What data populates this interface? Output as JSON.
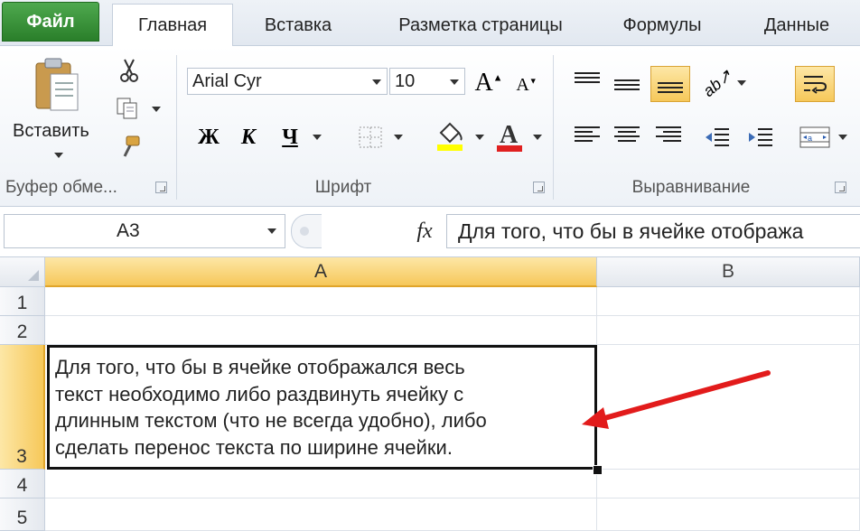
{
  "tabs": {
    "file": "Файл",
    "home": "Главная",
    "insert": "Вставка",
    "page_layout": "Разметка страницы",
    "formulas": "Формулы",
    "data": "Данные"
  },
  "ribbon": {
    "clipboard": {
      "paste_label": "Вставить",
      "group_label": "Буфер обме..."
    },
    "font": {
      "font_name": "Arial Cyr",
      "font_size": "10",
      "bold": "Ж",
      "italic": "К",
      "underline": "Ч",
      "group_label": "Шрифт",
      "font_color": "#e02020",
      "highlight_color": "#ffff00"
    },
    "alignment": {
      "group_label": "Выравнивание"
    }
  },
  "formula_bar": {
    "name_box": "A3",
    "fx": "fx",
    "content": "Для того, что бы в ячейке отобража"
  },
  "sheet": {
    "columns": [
      "A",
      "B"
    ],
    "rows": [
      "1",
      "2",
      "3",
      "4",
      "5"
    ],
    "cell_a3": "Для того, что бы в ячейке отображался весь\nтекст необходимо либо раздвинуть ячейку с\nдлинным текстом (что не всегда удобно), либо\nсделать перенос текста по ширине ячейки."
  },
  "annotation": {
    "arrow_color": "#e21b1b"
  }
}
